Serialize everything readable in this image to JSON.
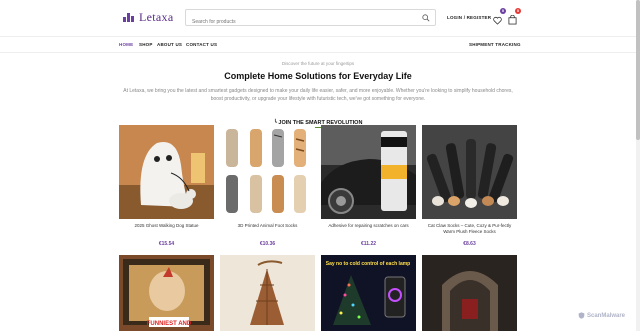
{
  "brand": {
    "name": "Letaxa",
    "color": "#5a2d86"
  },
  "search": {
    "placeholder": "Search for products"
  },
  "header": {
    "login_label": "LOGIN / REGISTER",
    "wishlist_count": "0",
    "cart_count": "0"
  },
  "nav": {
    "items": [
      "HOME",
      "SHOP",
      "ABOUT US",
      "CONTACT US"
    ],
    "right_link": "SHIPMENT TRACKING"
  },
  "hero": {
    "tagline": "Discover the future at your fingertips",
    "headline": "Complete Home Solutions for Everyday Life",
    "intro": "At Letaxa, we bring you the latest and smartest gadgets designed to make your daily life easier, safer, and more enjoyable. Whether you're looking to simplify household chores, boost productivity, or upgrade your lifestyle with futuristic tech, we've got something for everyone.",
    "cta": "╰ JOIN THE SMART REVOLUTION"
  },
  "products": [
    {
      "title": "2025 Ghost Walking Dog Statue",
      "price": "€15.54"
    },
    {
      "title": "3D Printed Animal Foot Socks",
      "price": "€10.36"
    },
    {
      "title": "Adhesive for repairing scratches on cars",
      "price": "€11.22"
    },
    {
      "title": "Cat Claw Socks – Cute, Cozy & Pur-fectly Warm Plush Fleece Socks",
      "price": "€8.63"
    }
  ],
  "second_row_images": [
    {
      "caption": "FUNNIEST AND"
    },
    {
      "caption": ""
    },
    {
      "caption": "Say no to cold control of each lamp"
    },
    {
      "caption": ""
    }
  ],
  "watermark": "ScanMalware",
  "accent_color": "#6b3fa0"
}
